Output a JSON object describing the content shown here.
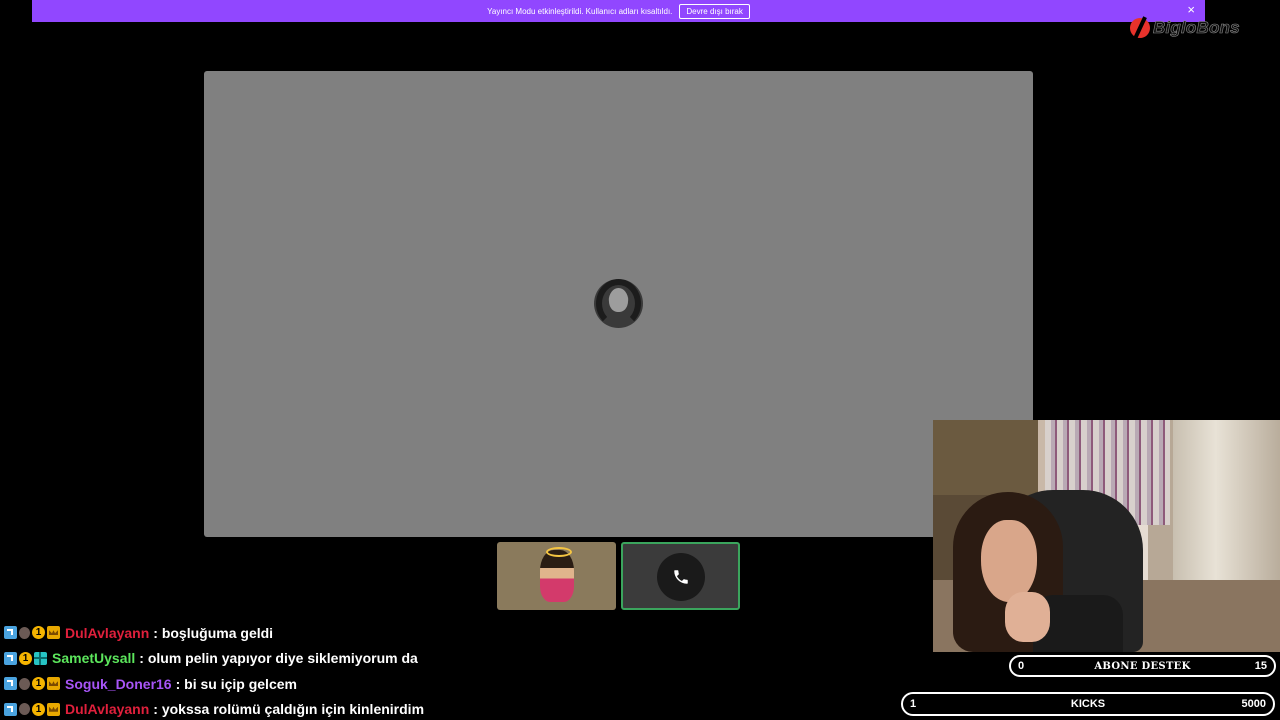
{
  "banner": {
    "text": "Yayıncı Modu etkinleştirildi. Kullanıcı adları kısaltıldı.",
    "button_label": "Devre dışı bırak",
    "close_label": "×",
    "color": "#9147ff"
  },
  "logo": {
    "text": "BigloBons",
    "mark_color": "#e8322b"
  },
  "call": {
    "panel_color": "#808080",
    "active_speaker_color": "#3ba55d"
  },
  "chat": {
    "messages": [
      {
        "user": "DulAvlayann",
        "user_color": "#e0203c",
        "text": ": boşluğuma geldi",
        "badges": [
          "prime",
          "face",
          "num",
          "crown"
        ]
      },
      {
        "user": "SametUysall",
        "user_color": "#5ce65c",
        "text": ": olum pelin yapıyor diye siklemiyorum da",
        "badges": [
          "prime",
          "num",
          "grid"
        ]
      },
      {
        "user": "Soguk_Doner16",
        "user_color": "#a855f7",
        "text": ": bi su içip gelcem",
        "badges": [
          "prime",
          "face",
          "num",
          "crown"
        ]
      },
      {
        "user": "DulAvlayann",
        "user_color": "#e0203c",
        "text": ": yokssa rolümü çaldığın için kinlenirdim",
        "badges": [
          "prime",
          "face",
          "num",
          "crown"
        ]
      }
    ],
    "badge_num_label": "1"
  },
  "goals": {
    "sub": {
      "current": "0",
      "label": "ABONE DESTEK",
      "target": "15",
      "progress": 0
    },
    "kicks": {
      "current": "1",
      "label": "KICKS",
      "target": "5000",
      "progress": 0.0002
    },
    "fill_color": "#53fc18"
  }
}
